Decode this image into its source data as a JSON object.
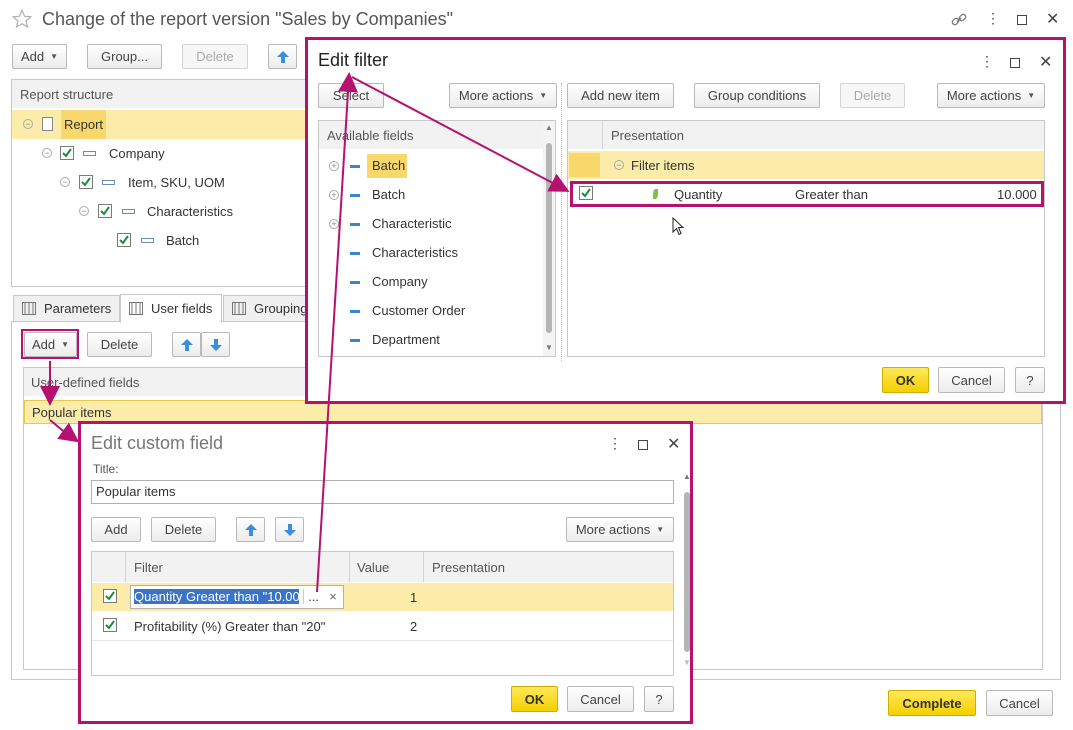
{
  "main": {
    "title": "Change of the report version \"Sales by Companies\"",
    "toolbar": {
      "add": "Add",
      "group": "Group...",
      "delete": "Delete"
    },
    "structure_header": "Report structure",
    "tree": [
      {
        "label": "Report"
      },
      {
        "label": "Company"
      },
      {
        "label": "Item, SKU, UOM"
      },
      {
        "label": "Characteristics"
      },
      {
        "label": "Batch"
      }
    ],
    "tabs": [
      "Parameters",
      "User fields",
      "Grouping"
    ],
    "tab_toolbar": {
      "add": "Add",
      "delete": "Delete"
    },
    "user_fields_header": "User-defined fields",
    "user_fields": [
      "Popular items"
    ],
    "complete": "Complete",
    "cancel": "Cancel"
  },
  "edit_filter": {
    "title": "Edit filter",
    "select": "Select",
    "more_actions_left": "More actions",
    "add_new_item": "Add new item",
    "group_conditions": "Group conditions",
    "delete": "Delete",
    "more_actions_right": "More actions",
    "available_header": "Available fields",
    "available_fields": [
      "Batch",
      "Batch",
      "Characteristic",
      "Characteristics",
      "Company",
      "Customer Order",
      "Department"
    ],
    "presentation_header": "Presentation",
    "filter_group": "Filter items",
    "filter_row": {
      "field": "Quantity",
      "condition": "Greater than",
      "value": "10.000"
    },
    "ok": "OK",
    "cancel": "Cancel",
    "help": "?"
  },
  "edit_custom": {
    "title": "Edit custom field",
    "title_label": "Title:",
    "title_value": "Popular items",
    "add": "Add",
    "delete": "Delete",
    "more_actions": "More actions",
    "columns": {
      "filter": "Filter",
      "value": "Value",
      "presentation": "Presentation"
    },
    "rows": [
      {
        "filter": "Quantity Greater than \"10.00",
        "value": "1",
        "ellipsis": "...",
        "clear": "×"
      },
      {
        "filter": "Profitability (%) Greater than \"20\"",
        "value": "2"
      }
    ],
    "ok": "OK",
    "cancel": "Cancel",
    "help": "?"
  },
  "colors": {
    "accent": "#b5116e",
    "selected": "#fbecaa",
    "yellow_button": "#f5cf00"
  }
}
